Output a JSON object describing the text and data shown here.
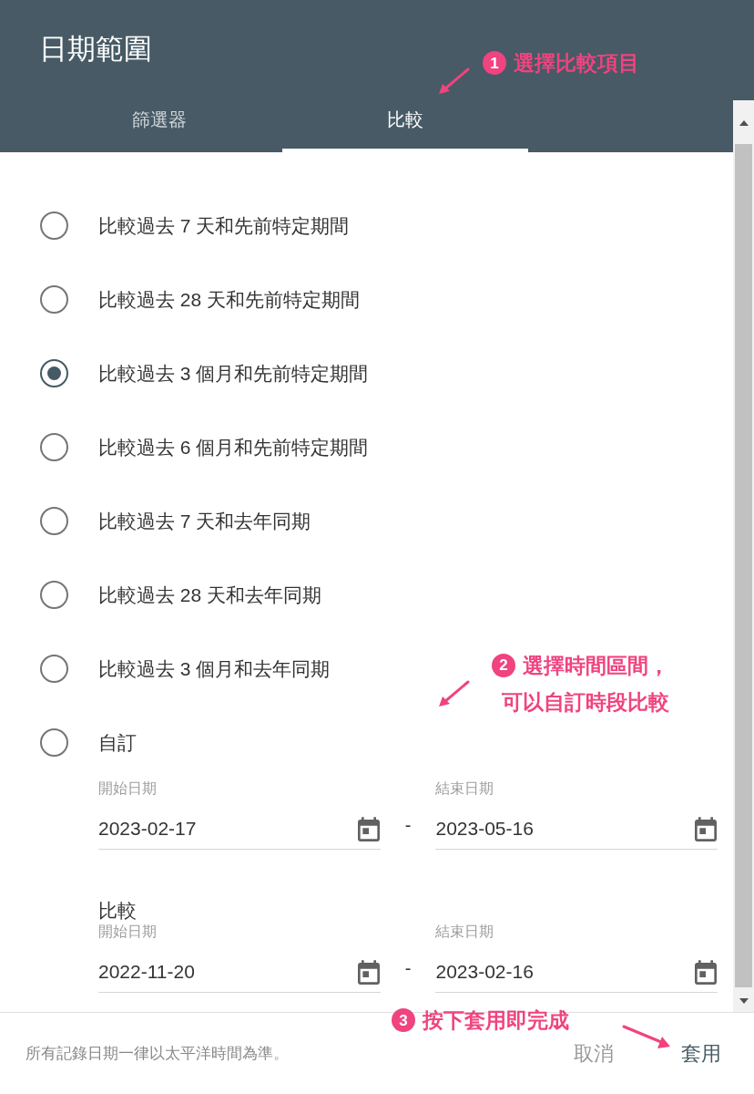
{
  "dialog": {
    "title": "日期範圍"
  },
  "tabs": [
    {
      "label": "篩選器",
      "selected": false
    },
    {
      "label": "比較",
      "selected": true
    }
  ],
  "options": [
    {
      "label": "比較過去 7 天和先前特定期間",
      "selected": false
    },
    {
      "label": "比較過去 28 天和先前特定期間",
      "selected": false
    },
    {
      "label": "比較過去 3 個月和先前特定期間",
      "selected": true
    },
    {
      "label": "比較過去 6 個月和先前特定期間",
      "selected": false
    },
    {
      "label": "比較過去 7 天和去年同期",
      "selected": false
    },
    {
      "label": "比較過去 28 天和去年同期",
      "selected": false
    },
    {
      "label": "比較過去 3 個月和去年同期",
      "selected": false
    },
    {
      "label": "自訂",
      "selected": false
    }
  ],
  "custom_range": {
    "start_label": "開始日期",
    "start": "2023-02-17",
    "separator": "-",
    "end_label": "結束日期",
    "end": "2023-05-16"
  },
  "compare_heading": "比較",
  "compare_range": {
    "start_label": "開始日期",
    "start": "2022-11-20",
    "separator": "-",
    "end_label": "結束日期",
    "end": "2023-02-16"
  },
  "footer": {
    "note": "所有記錄日期一律以太平洋時間為準。",
    "cancel": "取消",
    "apply": "套用"
  },
  "annotations": [
    {
      "number": "1",
      "lines": [
        "選擇比較項目"
      ]
    },
    {
      "number": "2",
      "lines": [
        "選擇時間區間，",
        "可以自訂時段比較"
      ]
    },
    {
      "number": "3",
      "lines": [
        "按下套用即完成"
      ]
    }
  ]
}
